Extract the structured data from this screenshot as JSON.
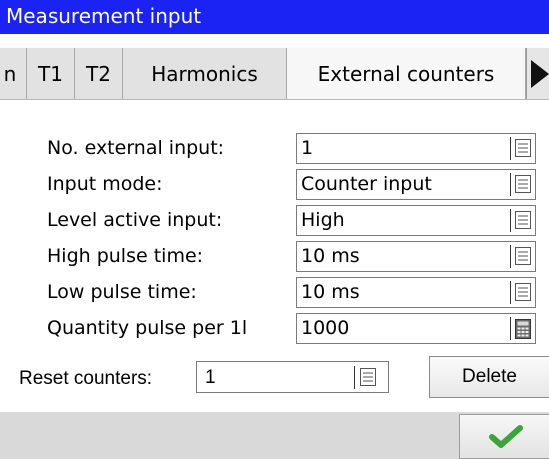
{
  "window": {
    "title": "Measurement input"
  },
  "tabs": [
    {
      "label": "n"
    },
    {
      "label": "T1"
    },
    {
      "label": "T2"
    },
    {
      "label": "Harmonics"
    },
    {
      "label": "External counters",
      "active": true
    }
  ],
  "fields": [
    {
      "label": "No. external input:",
      "value": "1",
      "button_icon": "list-icon"
    },
    {
      "label": "Input mode:",
      "value": "Counter input",
      "button_icon": "list-icon"
    },
    {
      "label": "Level active input:",
      "value": "High",
      "button_icon": "list-icon"
    },
    {
      "label": "High pulse time:",
      "value": "10 ms",
      "button_icon": "list-icon"
    },
    {
      "label": "Low pulse time:",
      "value": "10 ms",
      "button_icon": "list-icon"
    },
    {
      "label": "Quantity pulse per 1l",
      "value": "1000",
      "button_icon": "calculator-icon"
    }
  ],
  "reset": {
    "label": "Reset counters:",
    "value": "1",
    "button_icon": "list-icon"
  },
  "delete_label": "Delete",
  "ok_icon": "checkmark-icon",
  "colors": {
    "titlebar": "#1a22f4",
    "title_text": "#ffffff",
    "checkmark": "#3aa63a"
  }
}
